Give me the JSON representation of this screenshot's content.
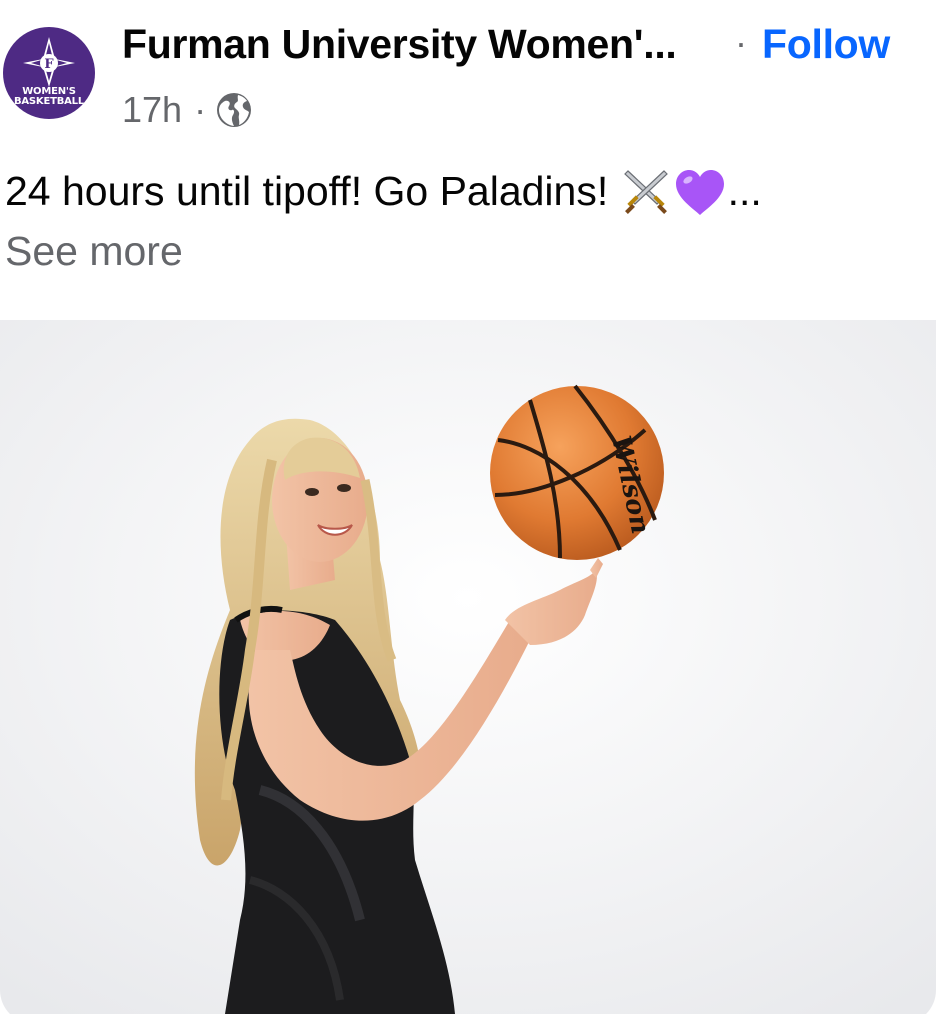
{
  "post": {
    "page_name": "Furman University Women'...",
    "separator": "·",
    "follow_label": "Follow",
    "timestamp": "17h",
    "meta_dot": "·",
    "audience_icon": "globe-icon",
    "text": "24 hours until tipoff! Go Paladins!",
    "emojis": [
      "crossed-swords-icon",
      "purple-heart-icon"
    ],
    "ellipsis": "...",
    "see_more": "See more"
  },
  "avatar": {
    "line1": "WOMEN'S",
    "line2": "BASKETBALL",
    "logo_letter": "F",
    "color": "#4e2a84"
  },
  "photo": {
    "description_icon": "player-with-basketball-photo",
    "ball_brand": "Wilson"
  },
  "colors": {
    "follow": "#0866ff",
    "secondary_text": "#65676b",
    "primary_text": "#050505"
  }
}
